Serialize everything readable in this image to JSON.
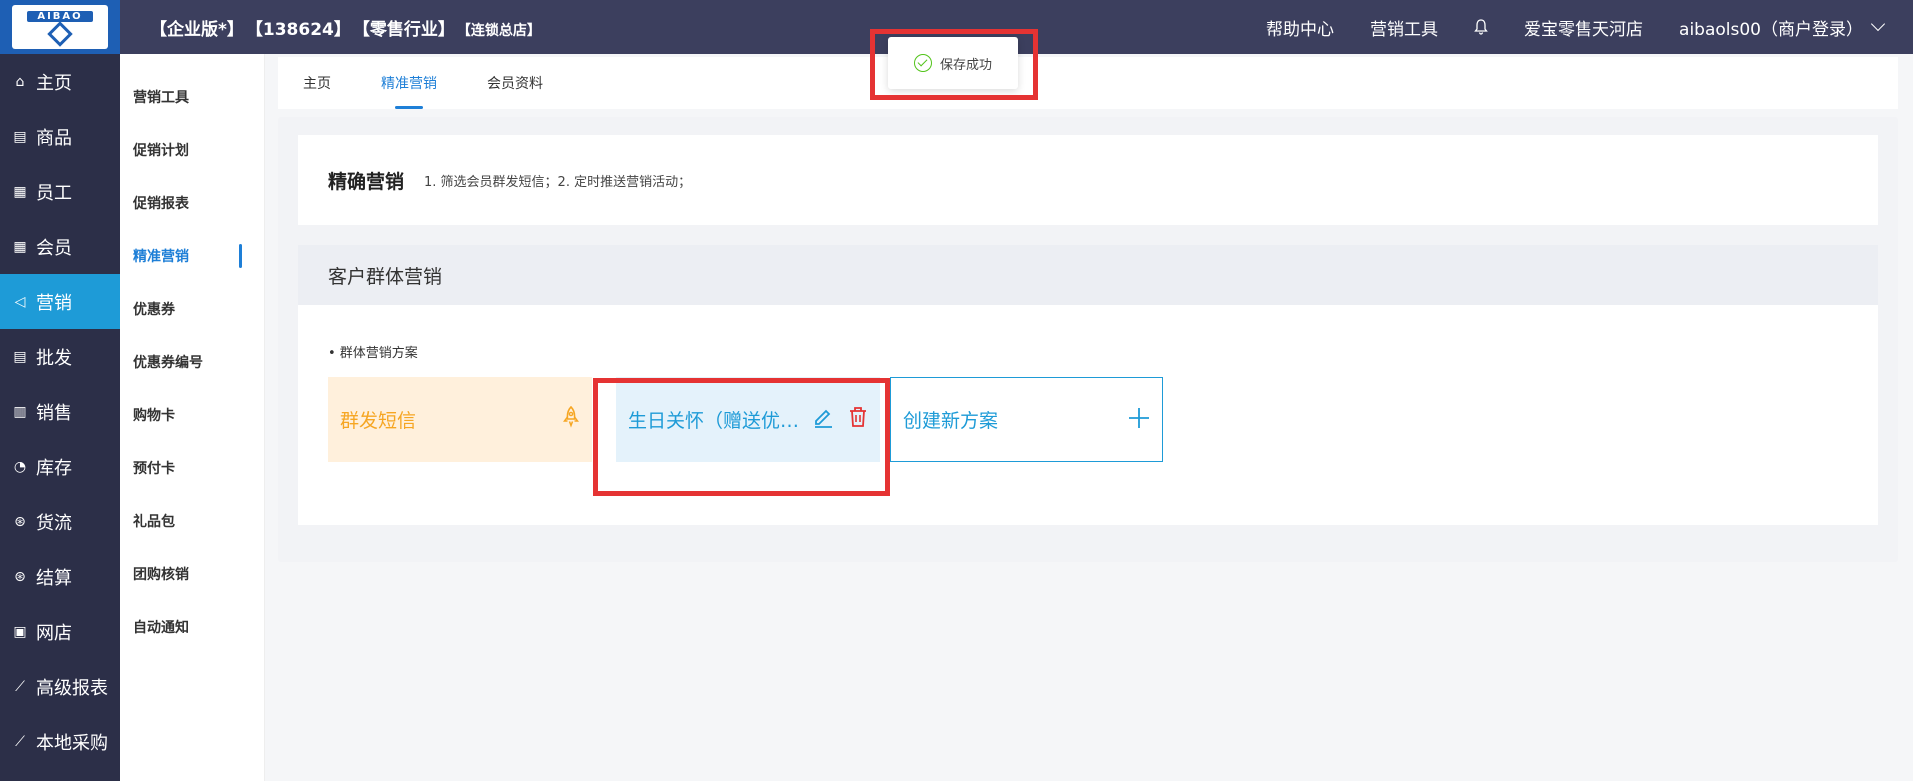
{
  "header": {
    "edition": "【企业版*】",
    "account_id": "【138624】",
    "industry": "【零售行业】",
    "store_type": "【连锁总店】",
    "nav": [
      "帮助中心",
      "营销工具"
    ],
    "store_name": "爱宝零售天河店",
    "user": "aibaols00（商户登录）",
    "logo_text": "AIBAO"
  },
  "sidebar": {
    "items": [
      {
        "label": "主页",
        "icon": "⌂"
      },
      {
        "label": "商品",
        "icon": "▤"
      },
      {
        "label": "员工",
        "icon": "▦"
      },
      {
        "label": "会员",
        "icon": "▦"
      },
      {
        "label": "营销",
        "icon": "◁"
      },
      {
        "label": "批发",
        "icon": "▤"
      },
      {
        "label": "销售",
        "icon": "▥"
      },
      {
        "label": "库存",
        "icon": "◔"
      },
      {
        "label": "货流",
        "icon": "⊛"
      },
      {
        "label": "结算",
        "icon": "⊛"
      },
      {
        "label": "网店",
        "icon": "▣"
      },
      {
        "label": "高级报表",
        "icon": "⟋"
      },
      {
        "label": "本地采购",
        "icon": "⟋"
      }
    ],
    "active_index": 4
  },
  "subsidebar": {
    "items": [
      "营销工具",
      "促销计划",
      "促销报表",
      "精准营销",
      "优惠券",
      "优惠券编号",
      "购物卡",
      "预付卡",
      "礼品包",
      "团购核销",
      "自动通知"
    ],
    "active_index": 3
  },
  "tabs": {
    "items": [
      "主页",
      "精准营销",
      "会员资料"
    ],
    "active_index": 1
  },
  "intro": {
    "title": "精确营销",
    "desc": "1. 筛选会员群发短信；2. 定时推送营销活动；"
  },
  "group": {
    "title": "客户群体营销",
    "section_label": "• 群体营销方案",
    "plans": {
      "sms": "群发短信",
      "birthday": "生日关怀（赠送优惠券）",
      "new": "创建新方案"
    }
  },
  "toast": {
    "message": "保存成功"
  },
  "colors": {
    "topbar": "#3c3f5e",
    "sidebar": "#2c2f48",
    "accent": "#1e9bd7",
    "highlight": "#e53333"
  }
}
